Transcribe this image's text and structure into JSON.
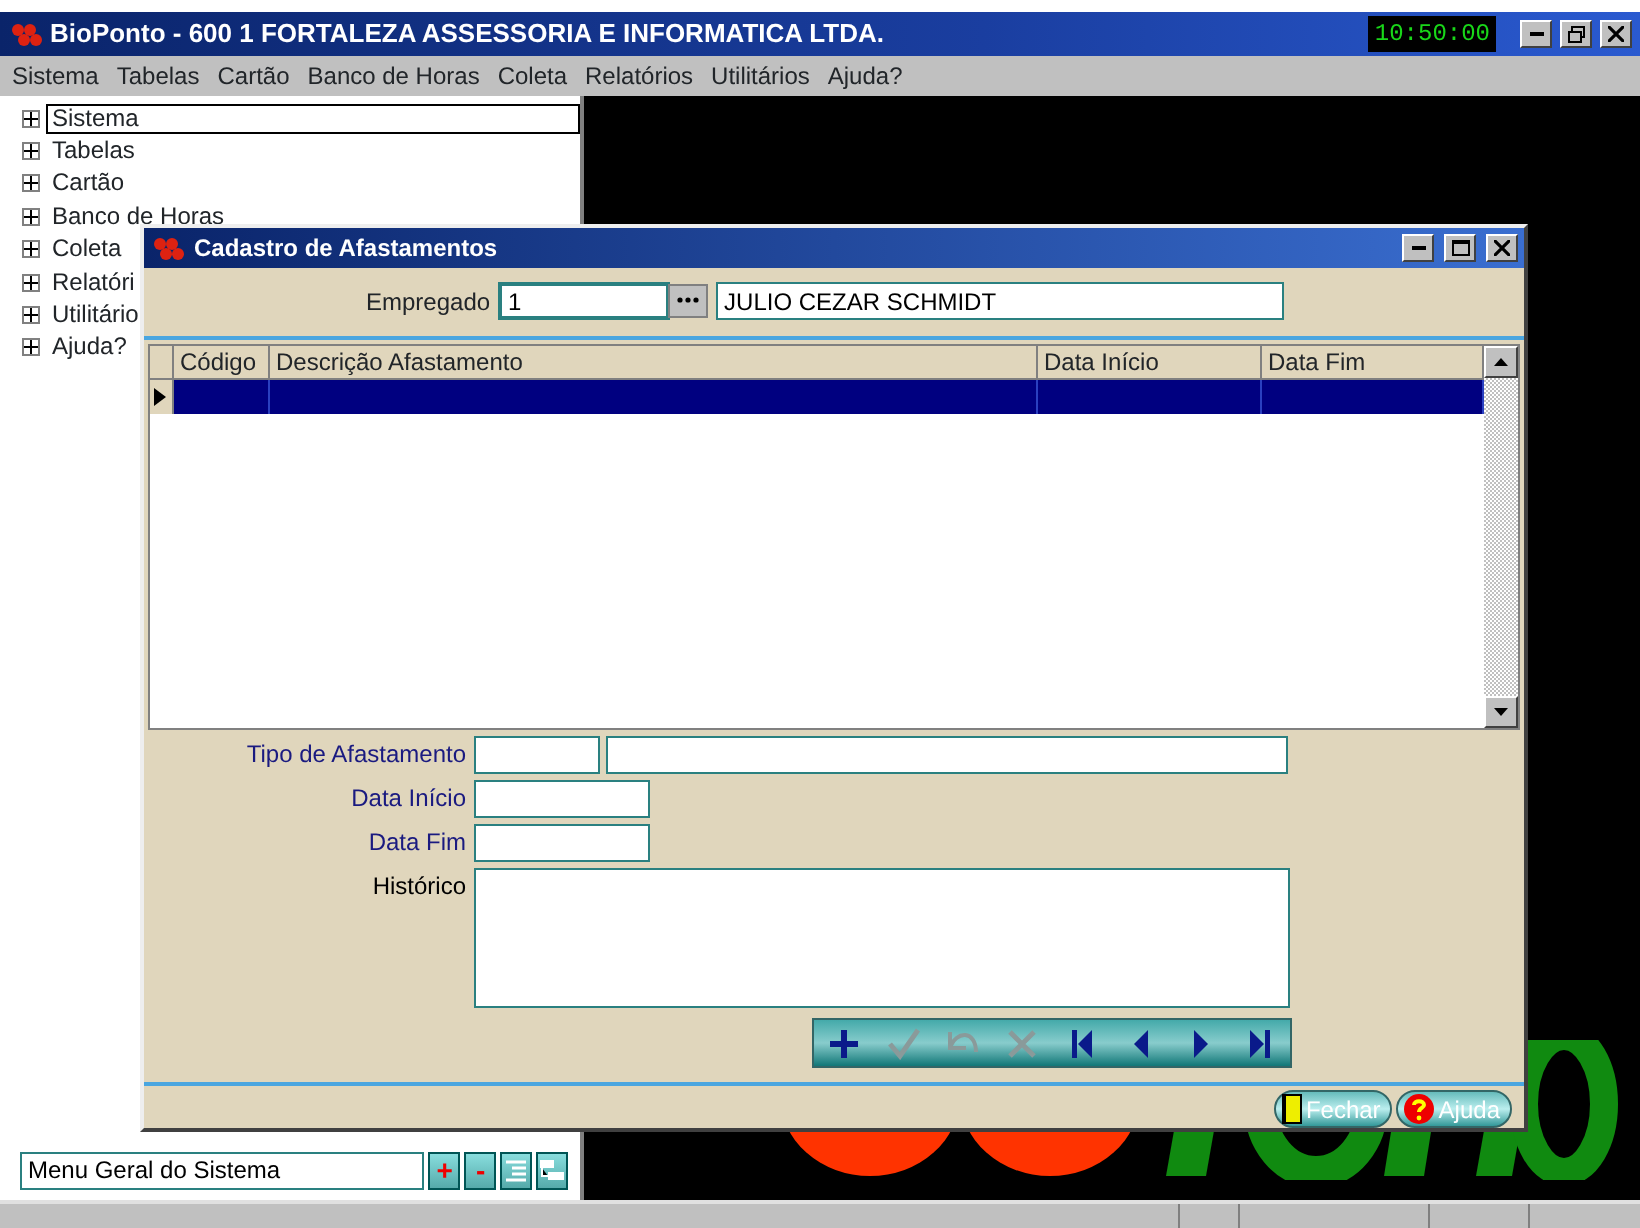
{
  "app_window": {
    "title": "BioPonto - 600 1 FORTALEZA ASSESSORIA E INFORMATICA LTDA.",
    "clock": "10:50:00"
  },
  "menu": [
    "Sistema",
    "Tabelas",
    "Cartão",
    "Banco de Horas",
    "Coleta",
    "Relatórios",
    "Utilitários",
    "Ajuda?"
  ],
  "tree": [
    {
      "label": "Sistema",
      "selected": true
    },
    {
      "label": "Tabelas",
      "selected": false
    },
    {
      "label": "Cartão",
      "selected": false
    },
    {
      "label": "Banco de Horas",
      "selected": false
    },
    {
      "label": "Coleta",
      "selected": false
    },
    {
      "label": "Relatóri",
      "selected": false
    },
    {
      "label": "Utilitário",
      "selected": false
    },
    {
      "label": "Ajuda?",
      "selected": false
    }
  ],
  "menu_search": {
    "value": "Menu Geral do Sistema",
    "buttons": [
      "+",
      "-"
    ]
  },
  "dialog": {
    "title": "Cadastro de Afastamentos",
    "employee": {
      "label": "Empregado",
      "code": "1",
      "name": "JULIO CEZAR SCHMIDT"
    },
    "table": {
      "columns": [
        "Código",
        "Descrição Afastamento",
        "Data Início",
        "Data Fim"
      ],
      "rows": [
        {
          "selected": true
        }
      ]
    },
    "form": {
      "type_label": "Tipo de Afastamento",
      "start_label": "Data Início",
      "end_label": "Data Fim",
      "history_label": "Histórico"
    },
    "navigator": [
      {
        "kind": "insert",
        "disabled": false
      },
      {
        "kind": "post",
        "disabled": true
      },
      {
        "kind": "cancel",
        "disabled": true
      },
      {
        "kind": "delete",
        "disabled": true
      },
      {
        "kind": "first",
        "disabled": false
      },
      {
        "kind": "prior",
        "disabled": false
      },
      {
        "kind": "next",
        "disabled": false
      },
      {
        "kind": "last",
        "disabled": false
      }
    ],
    "buttons": [
      {
        "kind": "close",
        "label": "Fechar"
      },
      {
        "kind": "help",
        "label": "Ajuda"
      }
    ]
  }
}
